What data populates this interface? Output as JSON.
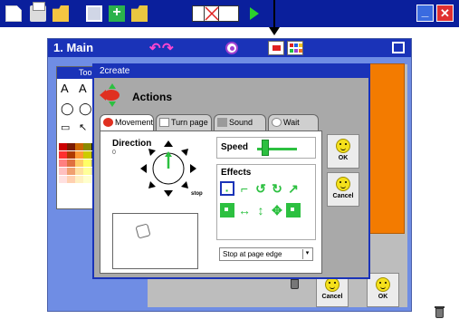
{
  "toolbar": {
    "icons": [
      "new-document-icon",
      "print-icon",
      "open-folder-icon",
      "save-icon",
      "add-page-icon",
      "open-folder-icon",
      "page-layout-icon",
      "play-icon",
      "minimize-icon",
      "close-icon"
    ]
  },
  "main_window": {
    "title": "1. Main",
    "undo_glyph": "↶",
    "redo_glyph": "↷"
  },
  "tools_panel": {
    "title": "Too",
    "swatches": [
      "#cc0000",
      "#7a1a00",
      "#cc6600",
      "#8a8a00",
      "#0a0a0a",
      "#ff3030",
      "#b03a00",
      "#ff9933",
      "#cccc00",
      "#444444",
      "#ff8080",
      "#e07040",
      "#ffcc66",
      "#ffff66",
      "#888888",
      "#ffc0c0",
      "#f0a070",
      "#ffe0a0",
      "#ffff99",
      "#cccccc",
      "#ffe0e0",
      "#ffd0b0",
      "#fff0c0",
      "#ffffcc",
      "#ffffff"
    ]
  },
  "dialog": {
    "title": "2create",
    "heading": "Actions",
    "tabs": [
      {
        "label": "Movement",
        "active": true
      },
      {
        "label": "Turn page",
        "active": false
      },
      {
        "label": "Sound",
        "active": false
      },
      {
        "label": "Wait",
        "active": false
      }
    ],
    "direction": {
      "label": "Direction",
      "value": "0",
      "stop_label": "stop"
    },
    "speed": {
      "label": "Speed",
      "level": 0.15
    },
    "effects": {
      "label": "Effects"
    },
    "edge_option": "Stop at page edge",
    "ok_label": "OK",
    "cancel_label": "Cancel"
  },
  "main_footer": {
    "cancel_label": "Cancel",
    "ok_label": "OK"
  },
  "colors": {
    "title_bar": "#1a33b8",
    "app_bar": "#0a1f9c",
    "canvas": "#f37b00",
    "accent_green": "#2cc040"
  }
}
